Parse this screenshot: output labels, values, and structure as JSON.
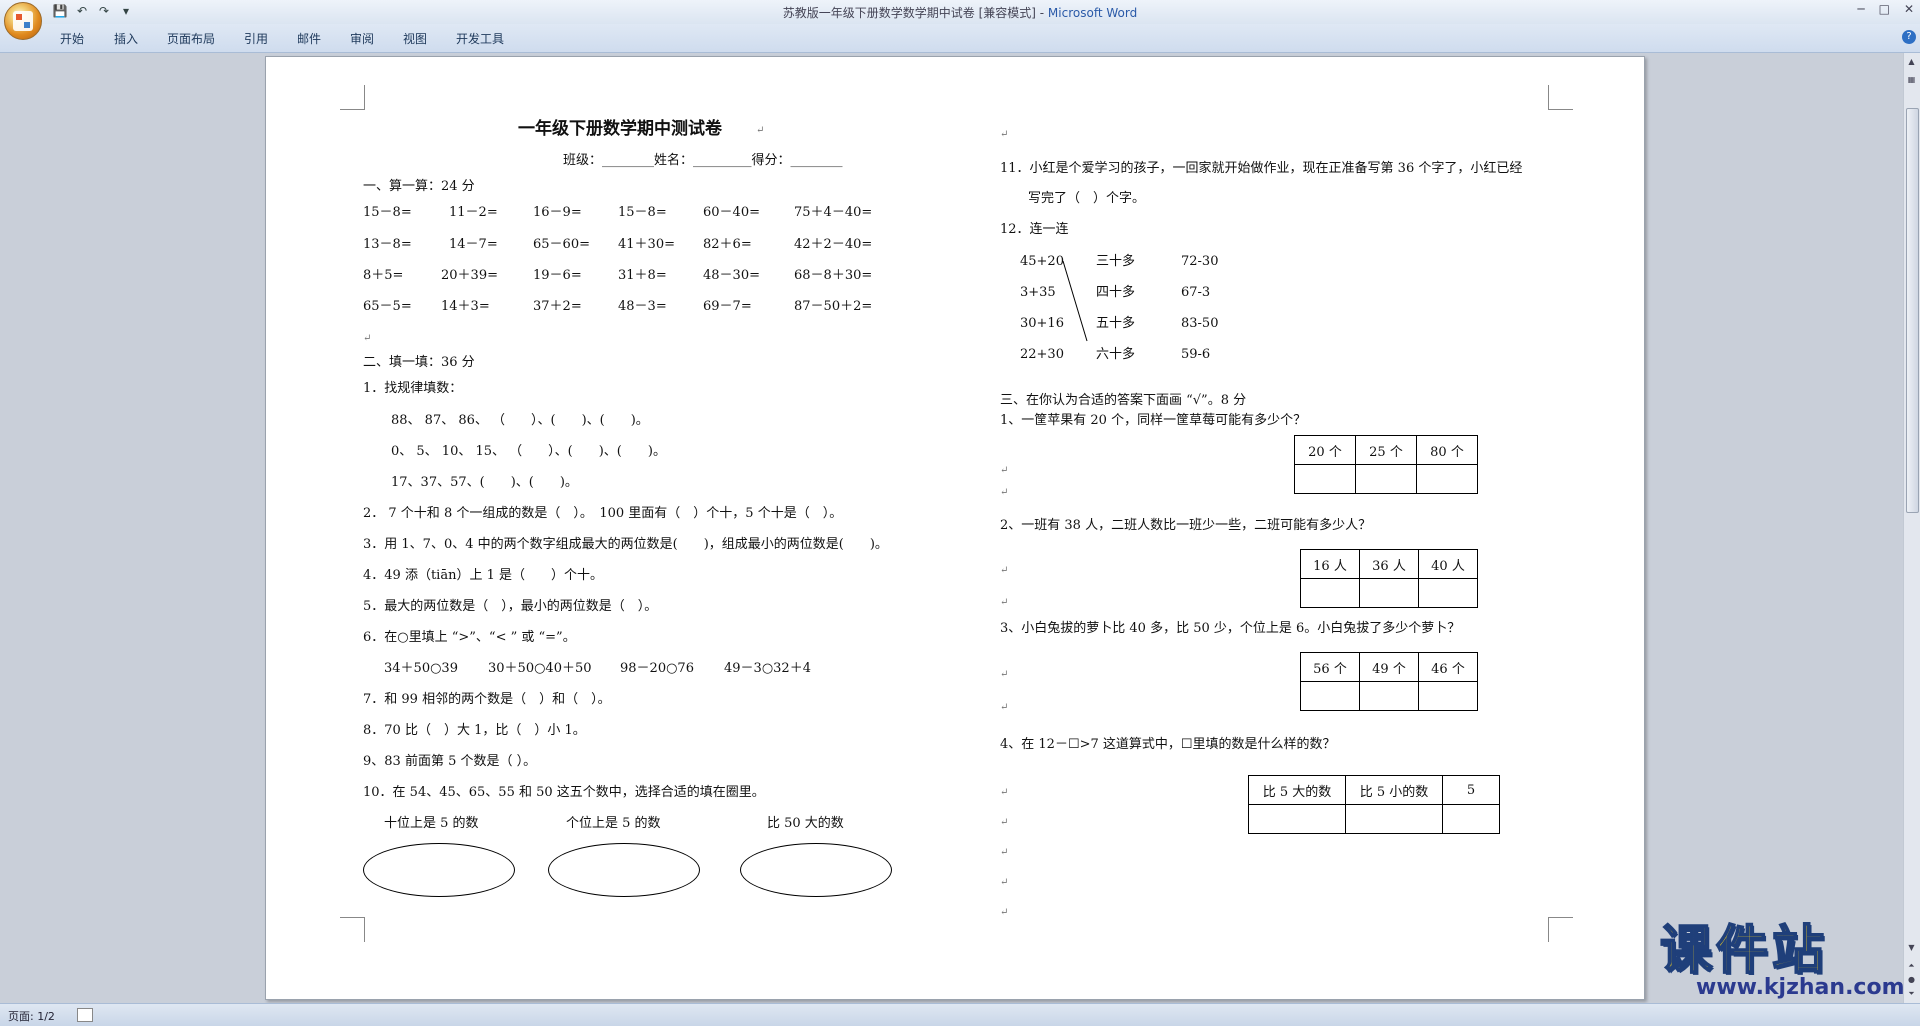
{
  "window": {
    "title": "苏教版一年级下册数学数学期中试卷 [兼容模式] - ",
    "app_name": "Microsoft Word"
  },
  "ribbon": {
    "tabs": [
      "开始",
      "插入",
      "页面布局",
      "引用",
      "邮件",
      "审阅",
      "视图",
      "开发工具"
    ]
  },
  "status": {
    "page": "页面: 1/2"
  },
  "doc": {
    "title": "一年级下册数学期中测试卷",
    "header_line": "班级：________姓名：_________得分：________",
    "s1_title": "一、算一算：24 分",
    "s1_rows": [
      [
        "15－8=",
        "11－2=",
        "16－9=",
        "15－8=",
        "60－40=",
        "75＋4－40="
      ],
      [
        "13－8=",
        "14－7=",
        "65－60=",
        "41＋30=",
        "82＋6=",
        "42＋2－40="
      ],
      [
        "8＋5=",
        "20＋39=",
        "19－6=",
        "31＋8=",
        "48－30=",
        "68－8＋30="
      ],
      [
        "65－5=",
        "14＋3=",
        "37＋2=",
        "48－3=",
        "69－7=",
        "87－50＋2="
      ]
    ],
    "s2_title": "二、填一填：36 分",
    "q1": "1．找规律填数：",
    "q1a": "88、 87、 86、 （　　）、(　　)、(　　)。",
    "q1b": "0、 5、 10、 15、 （　　）、(　　)、(　　)。",
    "q1c": "17、37、57、(　　)、(　　)。",
    "q2": "2． 7 个十和 8 个一组成的数是（　）。　100 里面有（　）个十，5 个十是（　）。",
    "q3": "3．用 1、7、0、4 中的两个数字组成最大的两位数是(　　)，组成最小的两位数是(　　)。",
    "q4": "4．49 添（tiān）上 1 是（　　）个十。",
    "q5": "5．最大的两位数是（　），最小的两位数是（　）。",
    "q6": "6．在○里填上 “>”、“< ” 或 “=”。",
    "q6_items": [
      "34＋50○39",
      "30＋50○40＋50",
      "98－20○76",
      "49－3○32＋4"
    ],
    "q7": "7．和 99 相邻的两个数是（　）和（　）。",
    "q8": "8．70 比（　）大 1，比（　）小 1。",
    "q9": "9、83 前面第 5 个数是（ ）。",
    "q10": "10．在 54、45、65、55 和 50 这五个数中，选择合适的填在圈里。",
    "q10_labels": [
      "十位上是 5 的数",
      "个位上是 5 的数",
      "比 50 大的数"
    ],
    "q11a": "11．小红是个爱学习的孩子，一回家就开始做作业，现在正准备写第 36 个字了，小红已经",
    "q11b": "写完了（　）个字。",
    "q12": "12．连一连",
    "q12_left": [
      "45+20",
      "3+35",
      "30+16",
      "22+30"
    ],
    "q12_mid": [
      "三十多",
      "四十多",
      "五十多",
      "六十多"
    ],
    "q12_right": [
      "72-30",
      "67-3",
      "83-50",
      "59-6"
    ],
    "s3_title": "三、在你认为合适的答案下面画 “√”。8 分",
    "s3q1": "1、一筐苹果有 20 个，同样一筐草莓可能有多少个？",
    "s3t1": [
      "20 个",
      "25 个",
      "80 个"
    ],
    "s3q2": "2、一班有 38 人，二班人数比一班少一些，二班可能有多少人？",
    "s3t2": [
      "16 人",
      "36 人",
      "40 人"
    ],
    "s3q3": "3、小白兔拔的萝卜比 40 多，比 50 少，个位上是 6。小白兔拔了多少个萝卜？",
    "s3t3": [
      "56 个",
      "49 个",
      "46 个"
    ],
    "s3q4": "4、在 12－☐>7 这道算式中，☐里填的数是什么样的数？",
    "s3t4": [
      "比 5 大的数",
      "比 5 小的数",
      "5"
    ]
  },
  "watermark": {
    "text": "课件站",
    "url": "www.kjzhan.com"
  }
}
